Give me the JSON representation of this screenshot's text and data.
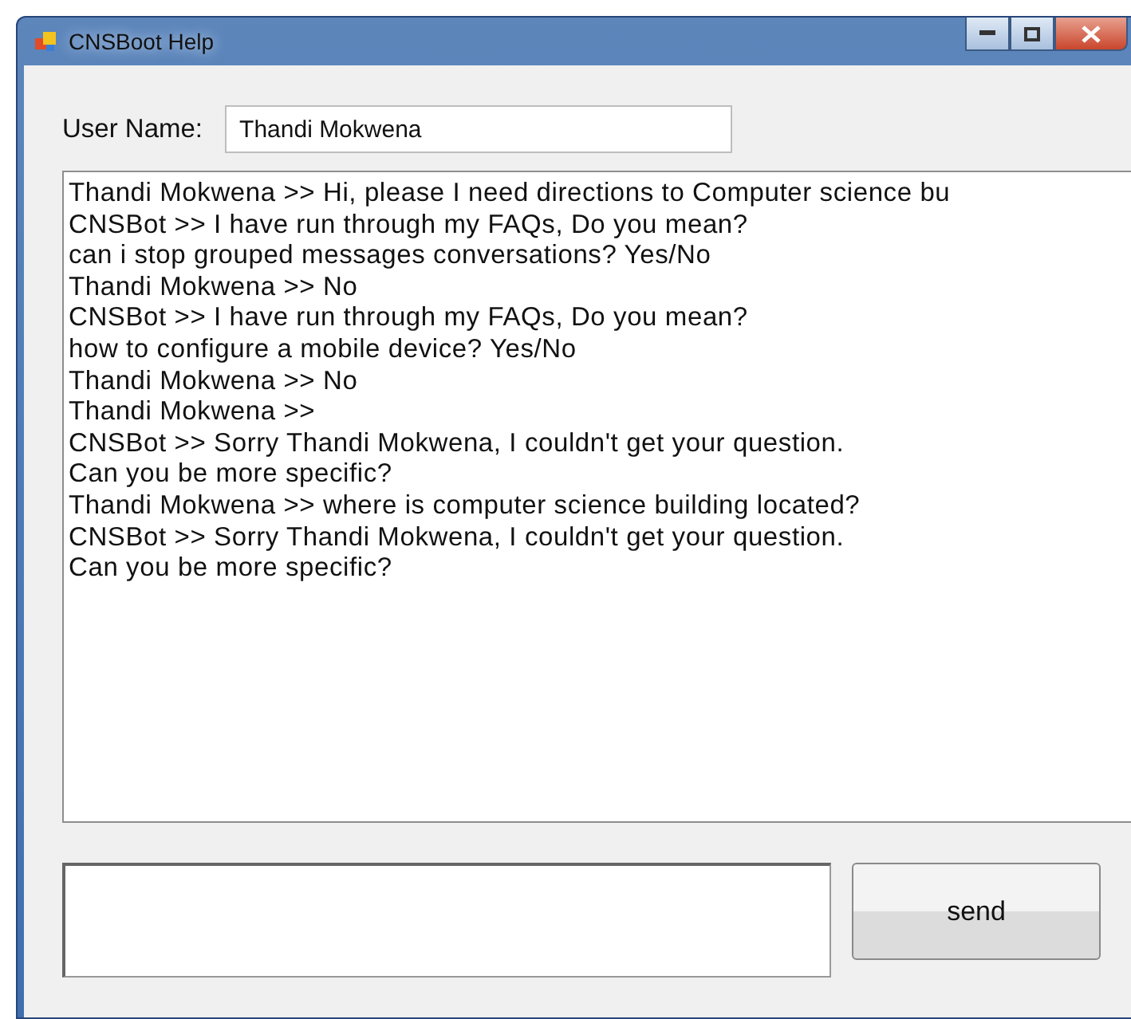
{
  "window": {
    "title": "CNSBoot Help"
  },
  "user_name": {
    "label": "User Name:",
    "value": "Thandi Mokwena"
  },
  "conversation": [
    "Thandi Mokwena >> Hi, please I need directions to Computer science bu",
    "CNSBot >> I have run through my FAQs, Do you mean?",
    "can i stop grouped messages conversations? Yes/No",
    "Thandi Mokwena >> No",
    "CNSBot >> I have run through my FAQs, Do you mean?",
    "how to configure a mobile device? Yes/No",
    "Thandi Mokwena >> No",
    "Thandi Mokwena >>",
    "CNSBot >> Sorry Thandi Mokwena, I couldn't get your question.",
    "Can you be more specific?",
    "Thandi Mokwena >> where is computer science building located?",
    "CNSBot >> Sorry Thandi Mokwena, I couldn't get your question.",
    "Can you be more specific?"
  ],
  "send_button": {
    "label": "send"
  }
}
